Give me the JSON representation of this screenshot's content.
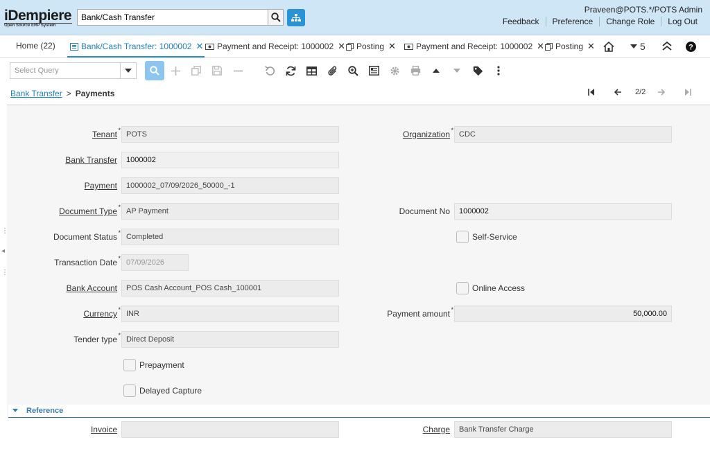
{
  "header": {
    "logo_main": "iDempiere",
    "logo_sub": "Open Source ERP System",
    "search_value": "Bank/Cash Transfer",
    "user": "Praveen@POTS.*/POTS Admin",
    "links": [
      "Feedback",
      "Preference",
      "Change Role",
      "Log Out"
    ]
  },
  "tabs": [
    {
      "label": "Home (22)",
      "icon": "home-tab",
      "closable": false
    },
    {
      "label": "Bank/Cash Transfer: 1000002",
      "icon": "list-icon",
      "closable": true,
      "active": true
    },
    {
      "label": "Payment and Receipt: 1000002",
      "icon": "money-icon",
      "closable": true
    },
    {
      "label": "Posting",
      "icon": "copy-icon",
      "closable": true
    },
    {
      "label": "Payment and Receipt: 1000002",
      "icon": "money-icon",
      "closable": true
    },
    {
      "label": "Posting",
      "icon": "copy-icon",
      "closable": true
    }
  ],
  "tab_count": "5",
  "toolbar": {
    "query_placeholder": "Select Query"
  },
  "breadcrumb": {
    "parent": "Bank Transfer",
    "separator": ">",
    "current": "Payments"
  },
  "record_nav": {
    "position": "2/2"
  },
  "form": {
    "tenant_label": "Tenant",
    "tenant": "POTS",
    "organization_label": "Organization",
    "organization": "CDC",
    "bank_transfer_label": "Bank Transfer",
    "bank_transfer": "1000002",
    "payment_label": "Payment",
    "payment": "1000002_07/09/2026_50000_-1",
    "document_type_label": "Document Type",
    "document_type": "AP Payment",
    "document_no_label": "Document No",
    "document_no": "1000002",
    "document_status_label": "Document Status",
    "document_status": "Completed",
    "self_service_label": "Self-Service",
    "transaction_date_label": "Transaction Date",
    "transaction_date": "07/09/2026",
    "bank_account_label": "Bank Account",
    "bank_account": "POS Cash Account_POS Cash_100001",
    "online_access_label": "Online Access",
    "currency_label": "Currency",
    "currency": "INR",
    "payment_amount_label": "Payment amount",
    "payment_amount": "50,000.00",
    "tender_type_label": "Tender type",
    "tender_type": "Direct Deposit",
    "prepayment_label": "Prepayment",
    "delayed_capture_label": "Delayed Capture",
    "reference_section": "Reference",
    "invoice_label": "Invoice",
    "invoice": "",
    "charge_label": "Charge",
    "charge": "Bank Transfer Charge"
  },
  "colors": {
    "header_bg": "#cfe6f7",
    "accent": "#2a93d5",
    "active_find": "#8cc6ef"
  }
}
